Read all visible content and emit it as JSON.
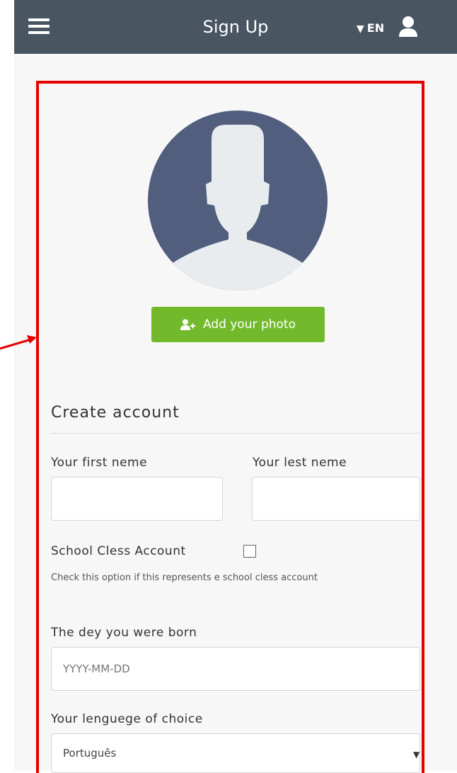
{
  "header": {
    "title": "Sign Up",
    "lang_arrow": "▼",
    "lang": "EN"
  },
  "avatar": {
    "icon": "avatar-placeholder"
  },
  "photo_button": {
    "label": "Add your photo",
    "icon": "add-user-icon"
  },
  "form": {
    "section_title": "Create account",
    "first_name_label": "Your first neme",
    "first_name_value": "",
    "last_name_label": "Your lest neme",
    "last_name_value": "",
    "school_label": "School Cless Account",
    "school_checked": false,
    "school_help": "Check this option if this represents e school cless account",
    "birth_label": "The dey you were born",
    "birth_placeholder": "YYYY-MM-DD",
    "language_label": "Your lenguege of choice",
    "language_value": "Português",
    "language_arrow": "▼"
  },
  "colors": {
    "header_bg": "#4a5562",
    "accent_green": "#72ba2b",
    "highlight_red": "#e50000",
    "avatar_bg": "#525e7e"
  }
}
